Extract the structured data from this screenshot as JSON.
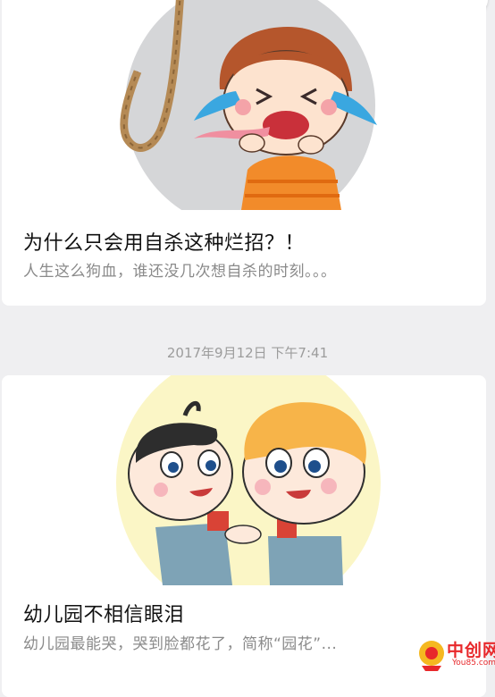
{
  "feed": {
    "articles": [
      {
        "title": "为什么只会用自杀这种烂招？！",
        "summary": "人生这么狗血，谁还没几次想自杀的时刻。。。",
        "illustration": "crying-cartoon-rope"
      },
      {
        "title": "幼儿园不相信眼泪",
        "summary": "幼儿园最能哭，哭到脸都花了，简称“园花”...",
        "illustration": "two-crying-kids"
      }
    ],
    "timestamp": "2017年9月12日 下午7:41"
  },
  "watermark": {
    "text": "中创网",
    "subtext": "You85.com"
  },
  "colors": {
    "background": "#efeff1",
    "card": "#ffffff",
    "title": "#111111",
    "summary": "#8a8a8a",
    "timestamp": "#9c9c9c",
    "watermark": "#e8282b"
  }
}
